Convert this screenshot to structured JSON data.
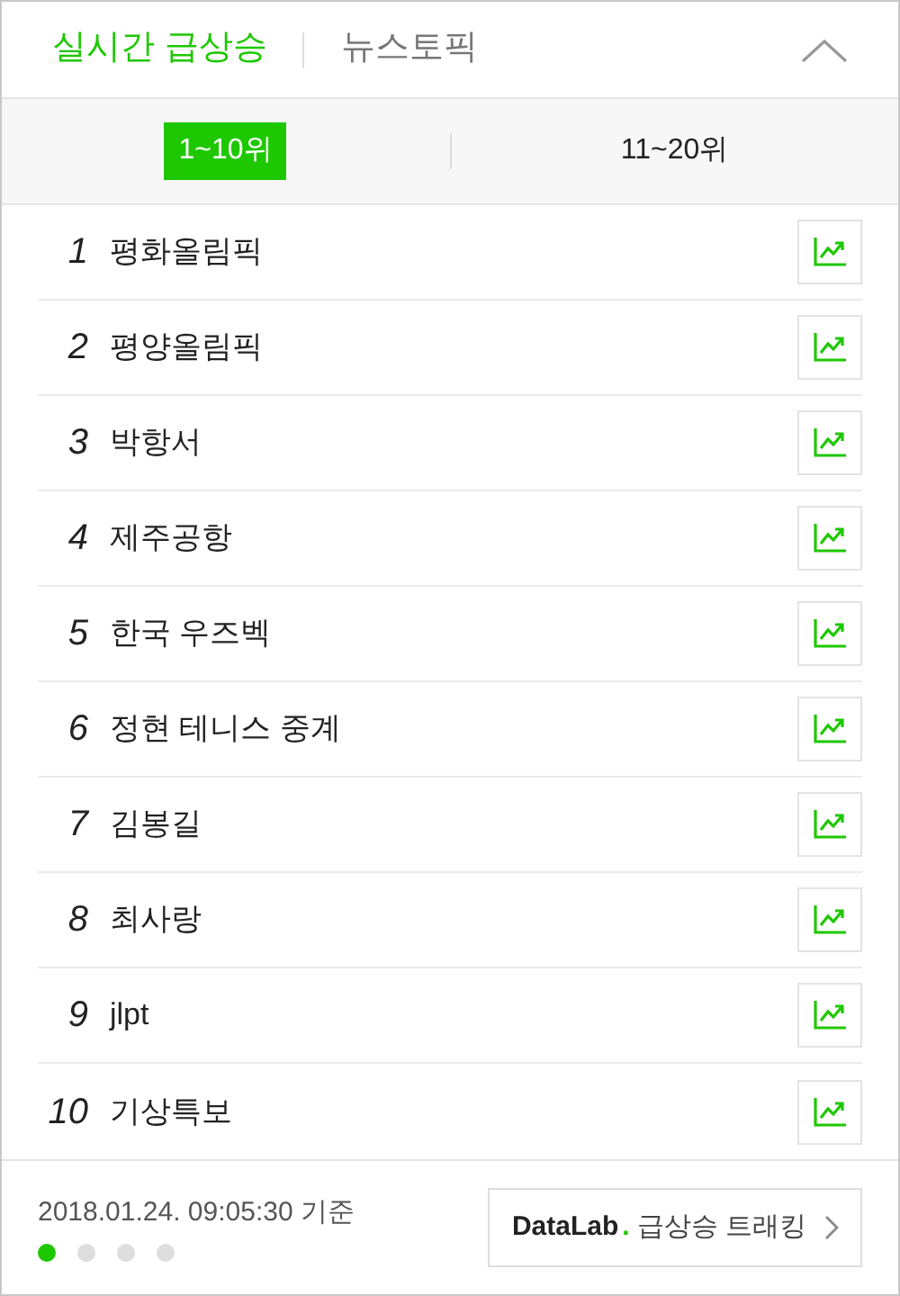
{
  "header_tabs": [
    {
      "label": "실시간 급상승",
      "selected": true
    },
    {
      "label": "뉴스토픽",
      "selected": false
    }
  ],
  "range_tabs": [
    {
      "label": "1~10위",
      "selected": true
    },
    {
      "label": "11~20위",
      "selected": false
    }
  ],
  "keywords": [
    {
      "rank": "1",
      "text": "평화올림픽"
    },
    {
      "rank": "2",
      "text": "평양올림픽"
    },
    {
      "rank": "3",
      "text": "박항서"
    },
    {
      "rank": "4",
      "text": "제주공항"
    },
    {
      "rank": "5",
      "text": "한국 우즈벡"
    },
    {
      "rank": "6",
      "text": "정현 테니스 중계"
    },
    {
      "rank": "7",
      "text": "김봉길"
    },
    {
      "rank": "8",
      "text": "최사랑"
    },
    {
      "rank": "9",
      "text": "jlpt"
    },
    {
      "rank": "10",
      "text": "기상특보"
    }
  ],
  "footer": {
    "timestamp": "2018.01.24. 09:05:30 기준",
    "pages": [
      {
        "selected": true
      },
      {
        "selected": false
      },
      {
        "selected": false
      },
      {
        "selected": false
      }
    ],
    "datalab_link": {
      "brand": "DataLab",
      "dot": ".",
      "label": "급상승 트래킹"
    }
  }
}
